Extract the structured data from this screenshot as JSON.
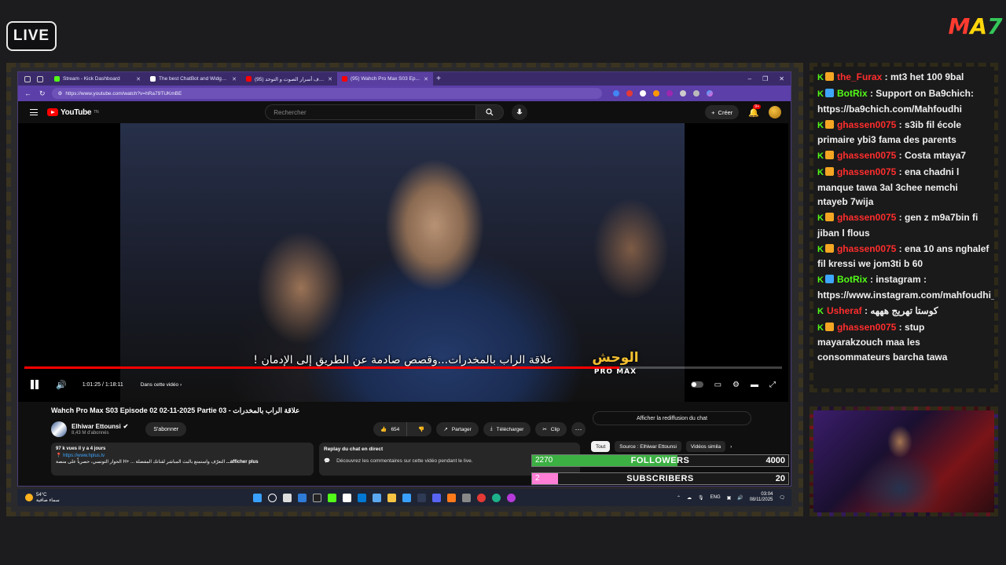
{
  "overlay": {
    "live_label": "LIVE",
    "brand": {
      "p1": "M",
      "p2": "A",
      "p3": "7"
    }
  },
  "browser": {
    "tabs": [
      {
        "title": "Stream - Kick Dashboard",
        "favicon_color": "#53fc18",
        "active": false
      },
      {
        "title": "The best ChatBot and Widgets f...",
        "favicon_color": "#ffffff",
        "active": false
      },
      {
        "title": "(95) إكتشاف أسرار الصوت و التوحد...",
        "favicon_color": "#ff0000",
        "active": false
      },
      {
        "title": "(95) Wahch Pro Max S03 Ep...",
        "favicon_color": "#ff0000",
        "active": true
      }
    ],
    "url": "https://www.youtube.com/watch?v=hRa79TUKmBE"
  },
  "youtube": {
    "logo_text": "YouTube",
    "logo_region": "TN",
    "search_placeholder": "Rechercher",
    "create_label": "Créer",
    "notif_count": "9+"
  },
  "video": {
    "subtitle": "علاقة الراب بالمخدرات...وقصص صادمة عن الطريق إلى الإدمان !",
    "show_logo_ar": "الوحش",
    "show_logo_en": "PRO MAX",
    "time_display": "1:01:25 / 1:18:11",
    "chapter_label": "Dans cette vidéo",
    "progress_fraction": 0.785
  },
  "meta": {
    "title": "Wahch Pro Max S03 Episode 02 02-11-2025 Partie 03 - علاقة الراب بالمخدرات",
    "channel_name": "Elhiwar Ettounsi",
    "subscribers": "8,43 M d'abonnés",
    "subscribe_label": "S'abonner",
    "likes": "654",
    "share_label": "Partager",
    "download_label": "Télécharger",
    "clip_label": "Clip",
    "chat_replay_button": "Afficher la rediffusion du chat",
    "desc_stats": "97 k vues  il y a 4 jours",
    "desc_link": "https://www.hplus.tv",
    "desc_text": "الحوار التونسي، حصرياً على منصة H+ ... التعرّف واستمتع بالبث المباشر لقناتك المفضلة",
    "desc_more": "...afficher plus",
    "replay_header": "Replay du chat en direct",
    "replay_text": "Découvrez les commentaires sur cette vidéo pendant le live.",
    "chips": [
      "Tout",
      "Source : Elhiwar Ettounsi",
      "Vidéos simila"
    ]
  },
  "taskbar": {
    "temp": "54°C",
    "weather_text": "سماء صافية",
    "lang": "ENG",
    "time": "03:04",
    "date": "08/11/2025"
  },
  "goals": {
    "followers": {
      "current": "2270",
      "label": "FOLLOWERS",
      "target": "4000",
      "fraction": 0.5675,
      "color": "#3cb043"
    },
    "subscribers": {
      "current": "2",
      "label": "SUBSCRIBERS",
      "target": "20",
      "fraction": 0.1,
      "color": "#ff7fd6"
    }
  },
  "chat": {
    "messages": [
      {
        "user": "the_Furax",
        "user_color": "#ff2d2d",
        "badge": "#f5a623",
        "text": "mt3 het 100 9bal"
      },
      {
        "user": "BotRix",
        "user_color": "#53fc18",
        "badge": "#3ea6ff",
        "text": "Support on Ba9chich: https://ba9chich.com/Mahfoudhi"
      },
      {
        "user": "ghassen0075",
        "user_color": "#ff2d2d",
        "badge": "#f5a623",
        "text": "s3ib fil école primaire ybi3 fama des parents"
      },
      {
        "user": "ghassen0075",
        "user_color": "#ff2d2d",
        "badge": "#f5a623",
        "text": "Costa mtaya7"
      },
      {
        "user": "ghassen0075",
        "user_color": "#ff2d2d",
        "badge": "#f5a623",
        "text": "ena chadni l manque tawa 3al 3chee nemchi ntayeb 7wija"
      },
      {
        "user": "ghassen0075",
        "user_color": "#ff2d2d",
        "badge": "#f5a623",
        "text": "gen z m9a7bin fi jiban l flous"
      },
      {
        "user": "ghassen0075",
        "user_color": "#ff2d2d",
        "badge": "#f5a623",
        "text": "ena 10 ans nghalef fil kressi we jom3ti b 60"
      },
      {
        "user": "BotRix",
        "user_color": "#53fc18",
        "badge": "#3ea6ff",
        "text": "instagram : https://www.instagram.com/mahfoudhi_tn/"
      },
      {
        "user": "Usheraf",
        "user_color": "#ff2d2d",
        "badge": "",
        "text": "كوستا تهريج هههه"
      },
      {
        "user": "ghassen0075",
        "user_color": "#ff2d2d",
        "badge": "#f5a623",
        "text": "stup mayarakzouch maa les consommateurs barcha tawa"
      }
    ]
  }
}
